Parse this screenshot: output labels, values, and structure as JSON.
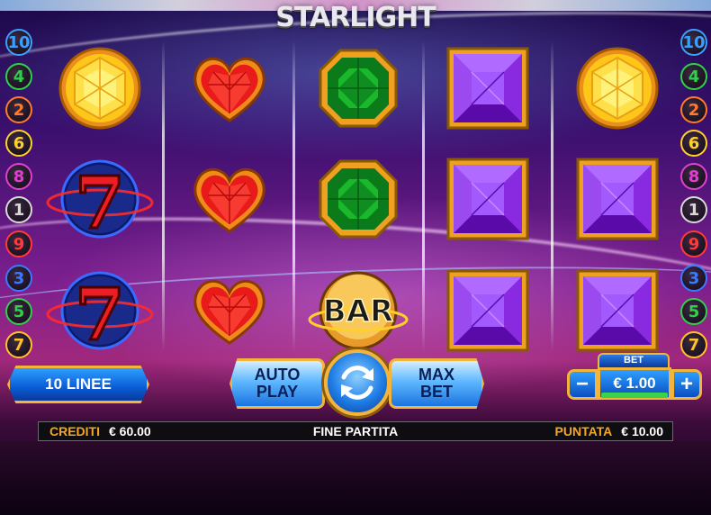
{
  "game": {
    "title": "STARLIGHT"
  },
  "paylines": {
    "left": [
      {
        "n": "10",
        "color": "#3aa0ff"
      },
      {
        "n": "4",
        "color": "#2fd04a"
      },
      {
        "n": "2",
        "color": "#ff7a2a"
      },
      {
        "n": "6",
        "color": "#ffd02a"
      },
      {
        "n": "8",
        "color": "#e040d0"
      },
      {
        "n": "1",
        "color": "#d8d8d8"
      },
      {
        "n": "9",
        "color": "#ff3a3a"
      },
      {
        "n": "3",
        "color": "#3a7aff"
      },
      {
        "n": "5",
        "color": "#2fd04a"
      },
      {
        "n": "7",
        "color": "#ffc02a"
      }
    ],
    "right": [
      {
        "n": "10",
        "color": "#3aa0ff"
      },
      {
        "n": "4",
        "color": "#2fd04a"
      },
      {
        "n": "2",
        "color": "#ff7a2a"
      },
      {
        "n": "6",
        "color": "#ffd02a"
      },
      {
        "n": "8",
        "color": "#e040d0"
      },
      {
        "n": "1",
        "color": "#d8d8d8"
      },
      {
        "n": "9",
        "color": "#ff3a3a"
      },
      {
        "n": "3",
        "color": "#3a7aff"
      },
      {
        "n": "5",
        "color": "#2fd04a"
      },
      {
        "n": "7",
        "color": "#ffc02a"
      }
    ]
  },
  "reels": [
    [
      "yellow-diamond",
      "lucky-seven",
      "lucky-seven"
    ],
    [
      "red-heart",
      "red-heart",
      "red-heart"
    ],
    [
      "green-emerald",
      "green-emerald",
      "bar"
    ],
    [
      "purple-square-gem",
      "purple-square-gem",
      "purple-square-gem"
    ],
    [
      "yellow-diamond",
      "purple-square-gem",
      "purple-square-gem"
    ]
  ],
  "symbol_text": {
    "bar": "BAR",
    "seven": "7"
  },
  "controls": {
    "lines_label": "10 LINEE",
    "auto_play_line1": "AUTO",
    "auto_play_line2": "PLAY",
    "max_bet_line1": "MAX",
    "max_bet_line2": "BET",
    "bet_caption": "BET",
    "bet_value": "€ 1.00",
    "bet_level_fraction": 1.0,
    "minus_label": "−",
    "plus_label": "+"
  },
  "status_bar": {
    "credits_label": "CREDITI",
    "credits_value": "€ 60.00",
    "center_text": "FINE PARTITA",
    "stake_label": "PUNTATA",
    "stake_value": "€ 10.00"
  },
  "colors": {
    "gold_border": "#f2b43a",
    "button_blue": "#0a5cd6",
    "label_orange": "#f5a623"
  }
}
